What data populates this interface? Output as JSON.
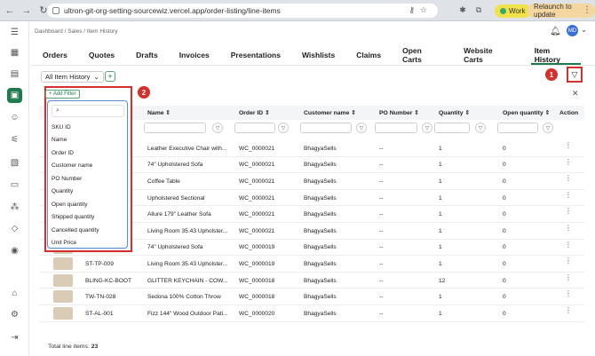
{
  "browser": {
    "url": "ultron-git-org-setting-sourcewiz.vercel.app/order-listing/line-items",
    "profile_label": "Work",
    "relaunch_label": "Relaunch to update"
  },
  "header": {
    "breadcrumb": "Dashboard  /  Sales  /  Item History",
    "avatar_initials": "MD"
  },
  "tabs": [
    "Orders",
    "Quotes",
    "Drafts",
    "Invoices",
    "Presentations",
    "Wishlists",
    "Claims",
    "Open Carts",
    "Website Carts",
    "Item History"
  ],
  "active_tab": "Item History",
  "view": {
    "label": "All Item History"
  },
  "callouts": {
    "one": "1",
    "two": "2"
  },
  "filter": {
    "add_label": "+ Add Filter",
    "options": [
      "SKU ID",
      "Name",
      "Order ID",
      "Customer name",
      "PO Number",
      "Quantity",
      "Open quantity",
      "Shipped quantity",
      "Cancelled quantity",
      "Unit Price"
    ]
  },
  "columns": {
    "name": "Name",
    "order_id": "Order ID",
    "customer": "Customer name",
    "po": "PO Number",
    "quantity": "Quantity",
    "open_qty": "Open quantity",
    "action": "Action"
  },
  "rows": [
    {
      "sku": "",
      "name": "Leather Executive Chair with...",
      "order": "WC_0000021",
      "customer": "BhagyaSells",
      "po": "--",
      "qty": "1",
      "open": "0"
    },
    {
      "sku": "",
      "name": "74\" Upholstered Sofa",
      "order": "WC_0000021",
      "customer": "BhagyaSells",
      "po": "--",
      "qty": "1",
      "open": "0"
    },
    {
      "sku": "",
      "name": "Coffee Table",
      "order": "WC_0000021",
      "customer": "BhagyaSells",
      "po": "--",
      "qty": "1",
      "open": "0"
    },
    {
      "sku": "",
      "name": "Upholstered Sectional",
      "order": "WC_0000021",
      "customer": "BhagyaSells",
      "po": "--",
      "qty": "1",
      "open": "0"
    },
    {
      "sku": "",
      "name": "Allure 179\" Leather Sofa",
      "order": "WC_0000021",
      "customer": "BhagyaSells",
      "po": "--",
      "qty": "1",
      "open": "0"
    },
    {
      "sku": "",
      "name": "Living Room 35.43 Upholster...",
      "order": "WC_0000021",
      "customer": "BhagyaSells",
      "po": "--",
      "qty": "1",
      "open": "0"
    },
    {
      "sku": "",
      "name": "74\" Upholstered Sofa",
      "order": "WC_0000019",
      "customer": "BhagyaSells",
      "po": "--",
      "qty": "1",
      "open": "0"
    },
    {
      "sku": "ST-TP-009",
      "name": "Living Room 35.43 Upholster...",
      "order": "WC_0000019",
      "customer": "BhagyaSells",
      "po": "--",
      "qty": "1",
      "open": "0"
    },
    {
      "sku": "BLING-KC-BOOT",
      "name": "GLITTER KEYCHAIN - COW...",
      "order": "WC_0000018",
      "customer": "BhagyaSells",
      "po": "--",
      "qty": "12",
      "open": "0"
    },
    {
      "sku": "TW-TN-028",
      "name": "Sedona 100% Cotton Throw",
      "order": "WC_0000018",
      "customer": "BhagyaSells",
      "po": "--",
      "qty": "1",
      "open": "0"
    },
    {
      "sku": "ST-AL-001",
      "name": "Fizz 144\" Wood Outdoor Pati...",
      "order": "WC_0000020",
      "customer": "BhagyaSells",
      "po": "--",
      "qty": "1",
      "open": "0"
    }
  ],
  "footer": {
    "total_label": "Total line items:",
    "total_value": "23"
  },
  "colors": {
    "accent": "#1f7a4d",
    "annotation": "#d6302d"
  }
}
